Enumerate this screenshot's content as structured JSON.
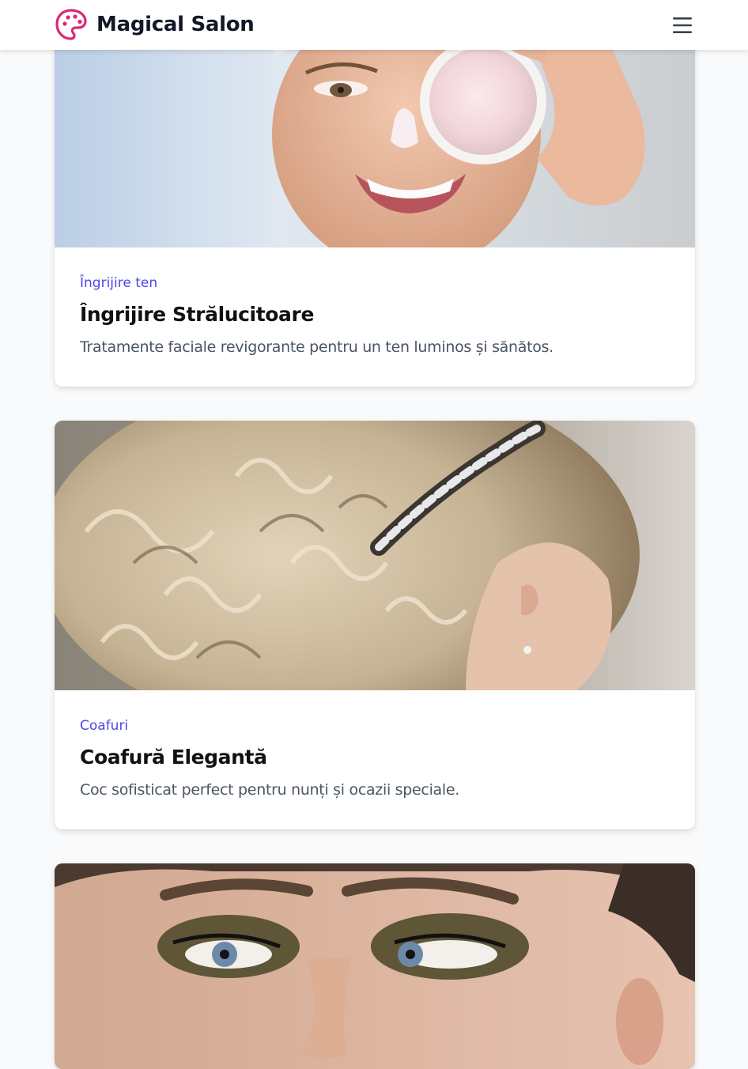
{
  "header": {
    "brand_name": "Magical Salon",
    "logo_icon": "palette-icon",
    "menu_icon": "hamburger-menu-icon",
    "accent_color": "#db2777"
  },
  "cards": [
    {
      "category": "Îngrijire ten",
      "title": "Îngrijire Strălucitoare",
      "description": "Tratamente faciale revigorante pentru un ten luminos și sănătos."
    },
    {
      "category": "Coafuri",
      "title": "Coafură Elegantă",
      "description": "Coc sofisticat perfect pentru nunți și ocazii speciale."
    },
    {
      "category": "",
      "title": "",
      "description": ""
    }
  ],
  "colors": {
    "category_text": "#4f46e5",
    "title_text": "#111111",
    "description_text": "#4b5563"
  }
}
